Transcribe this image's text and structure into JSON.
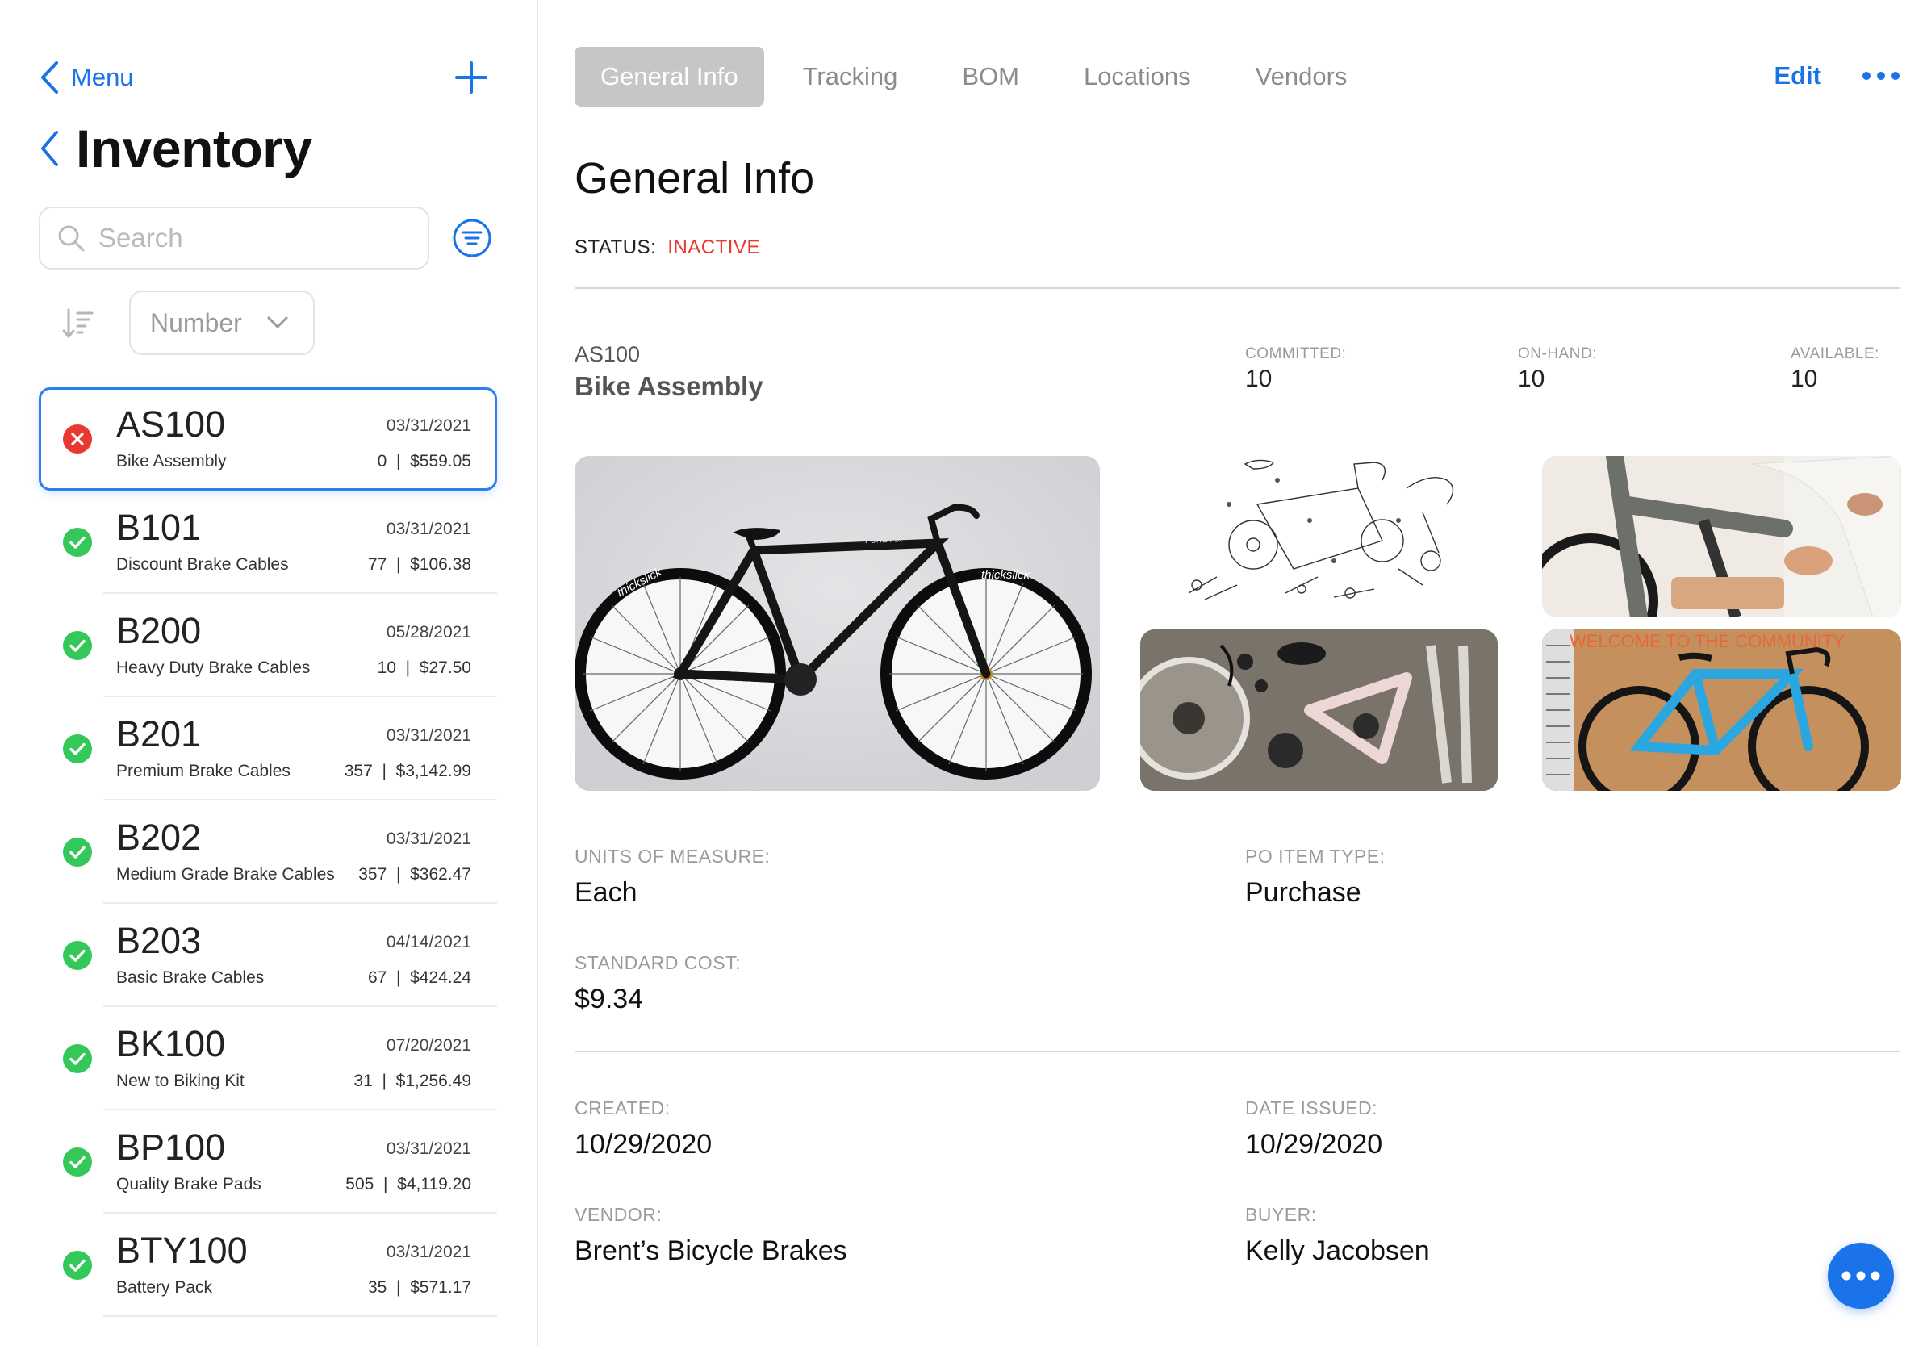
{
  "sidebar": {
    "back_label": "Menu",
    "title": "Inventory",
    "search_placeholder": "Search",
    "sort_field": "Number",
    "items": [
      {
        "number": "AS100",
        "date": "03/31/2021",
        "description": "Bike Assembly",
        "qty_price": "0  |  $559.05",
        "status": "inactive"
      },
      {
        "number": "B101",
        "date": "03/31/2021",
        "description": "Discount Brake Cables",
        "qty_price": "77  |  $106.38",
        "status": "active"
      },
      {
        "number": "B200",
        "date": "05/28/2021",
        "description": "Heavy Duty Brake Cables",
        "qty_price": "10  |  $27.50",
        "status": "active"
      },
      {
        "number": "B201",
        "date": "03/31/2021",
        "description": "Premium Brake Cables",
        "qty_price": "357  |  $3,142.99",
        "status": "active"
      },
      {
        "number": "B202",
        "date": "03/31/2021",
        "description": "Medium Grade Brake Cables",
        "qty_price": "357  |  $362.47",
        "status": "active"
      },
      {
        "number": "B203",
        "date": "04/14/2021",
        "description": "Basic Brake Cables",
        "qty_price": "67  |  $424.24",
        "status": "active"
      },
      {
        "number": "BK100",
        "date": "07/20/2021",
        "description": "New to Biking Kit",
        "qty_price": "31  |  $1,256.49",
        "status": "active"
      },
      {
        "number": "BP100",
        "date": "03/31/2021",
        "description": "Quality Brake Pads",
        "qty_price": "505  |  $4,119.20",
        "status": "active"
      },
      {
        "number": "BTY100",
        "date": "03/31/2021",
        "description": "Battery Pack",
        "qty_price": "35  |  $571.17",
        "status": "active"
      }
    ]
  },
  "tabs": [
    "General Info",
    "Tracking",
    "BOM",
    "Locations",
    "Vendors"
  ],
  "edit_label": "Edit",
  "detail": {
    "title": "General Info",
    "status_label": "STATUS:",
    "status_value": "INACTIVE",
    "item_code": "AS100",
    "item_name": "Bike Assembly",
    "committed_label": "COMMITTED:",
    "committed_value": "10",
    "onhand_label": "ON-HAND:",
    "onhand_value": "10",
    "available_label": "AVAILABLE:",
    "available_value": "10",
    "uom_label": "UNITS OF MEASURE:",
    "uom_value": "Each",
    "po_type_label": "PO ITEM TYPE:",
    "po_type_value": "Purchase",
    "std_cost_label": "STANDARD COST:",
    "std_cost_value": "$9.34",
    "created_label": "CREATED:",
    "created_value": "10/29/2020",
    "issued_label": "DATE ISSUED:",
    "issued_value": "10/29/2020",
    "vendor_label": "VENDOR:",
    "vendor_value": "Brent’s Bicycle Brakes",
    "buyer_label": "BUYER:",
    "buyer_value": "Kelly Jacobsen"
  },
  "photo_text": {
    "brand_tire": "thickslick",
    "brand_frame": "PURE FIX",
    "banner": "WELCOME TO THE COMMUNITY"
  },
  "colors": {
    "accent": "#1a73e8",
    "inactive": "#e8382f",
    "active": "#34c759",
    "tab_active_bg": "#c6c6c9"
  },
  "icons": {
    "back": "chevron-left-icon",
    "add": "plus-icon",
    "search": "search-icon",
    "filter": "filter-icon",
    "sort": "sort-icon",
    "more": "ellipsis-icon"
  }
}
